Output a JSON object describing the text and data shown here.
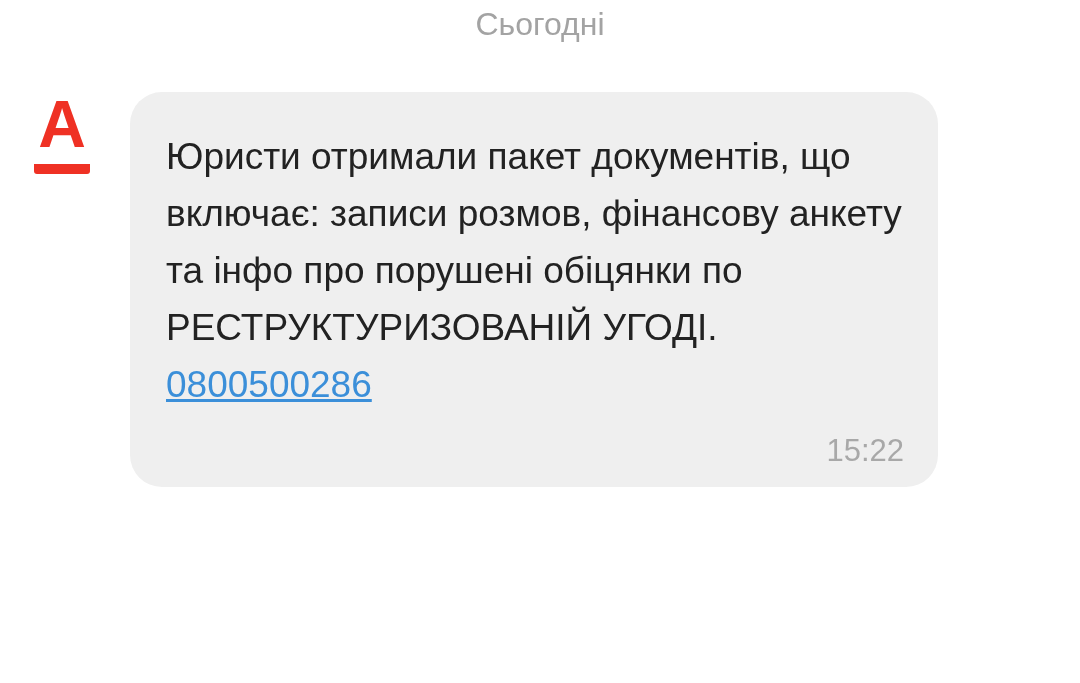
{
  "date_header": "Сьогодні",
  "sender": {
    "logo": "А"
  },
  "message": {
    "text": "Юристи отримали пакет документів, що включає: записи розмов, фінансову анкету та інфо про порушені обіцянки по РЕСТРУКТУРИЗОВАНІЙ УГОДІ.",
    "link": "0800500286",
    "time": "15:22"
  }
}
